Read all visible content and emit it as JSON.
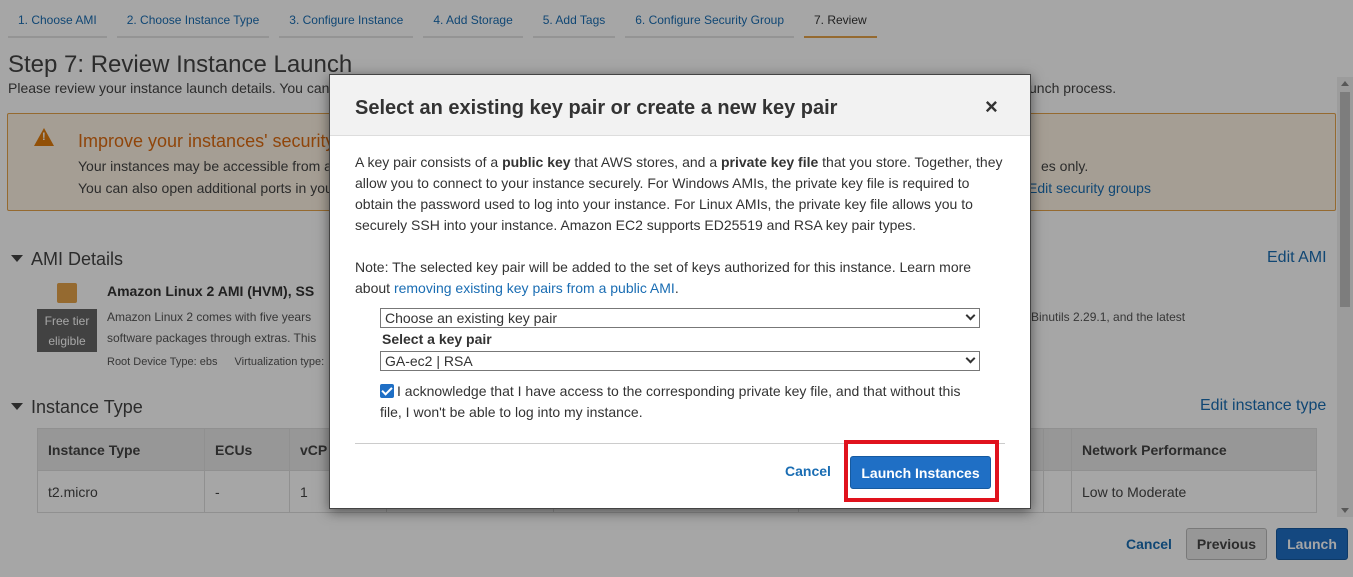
{
  "wizard": {
    "steps": [
      {
        "label": "1. Choose AMI"
      },
      {
        "label": "2. Choose Instance Type"
      },
      {
        "label": "3. Configure Instance"
      },
      {
        "label": "4. Add Storage"
      },
      {
        "label": "5. Add Tags"
      },
      {
        "label": "6. Configure Security Group"
      },
      {
        "label": "7. Review"
      }
    ]
  },
  "page": {
    "title": "Step 7: Review Instance Launch",
    "subtitle_start": "Please review your instance launch details. You can",
    "subtitle_end": "unch process."
  },
  "warning": {
    "title": "Improve your instances' security",
    "line1_start": "Your instances may be accessible from a",
    "line1_end": "es only.",
    "line2_start": "You can also open additional ports in you",
    "edit_link": "Edit security groups"
  },
  "ami": {
    "section_title": "AMI Details",
    "edit_link": "Edit AMI",
    "name": "Amazon Linux 2 AMI (HVM), SS",
    "badge": "Free tier eligible",
    "desc_line1_start": "Amazon Linux 2 comes with five years",
    "desc_line1_end": "Binutils 2.29.1, and the latest",
    "desc_line2": "software packages through extras. This",
    "meta_root": "Root Device Type: ebs",
    "meta_virt": "Virtualization type:"
  },
  "instance_type": {
    "section_title": "Instance Type",
    "edit_link": "Edit instance type",
    "columns": [
      "Instance Type",
      "ECUs",
      "vCP",
      "",
      "",
      "",
      "",
      "Network Performance"
    ],
    "rows": [
      [
        "t2.micro",
        "-",
        "1",
        "",
        "",
        "",
        "",
        "Low to Moderate"
      ]
    ]
  },
  "footer": {
    "cancel": "Cancel",
    "previous": "Previous",
    "launch": "Launch"
  },
  "modal": {
    "title": "Select an existing key pair or create a new key pair",
    "close": "×",
    "body_1": "A key pair consists of a ",
    "body_b1": "public key",
    "body_2": " that AWS stores, and a ",
    "body_b2": "private key file",
    "body_3": " that you store. Together, they allow you to connect to your instance securely. For Windows AMIs, the private key file is required to obtain the password used to log into your instance. For Linux AMIs, the private key file allows you to securely SSH into your instance. Amazon EC2 supports ED25519 and RSA key pair types.",
    "note_text": "Note: The selected key pair will be added to the set of keys authorized for this instance. Learn more about",
    "note_link": "removing existing key pairs from a public AMI",
    "note_end": ".",
    "select_mode": "Choose an existing key pair",
    "select_label": "Select a key pair",
    "select_key": "GA-ec2 | RSA",
    "acknowledge": "I acknowledge that I have access to the corresponding private key file, and that without this file, I won't be able to log into my instance.",
    "acknowledge_checked": true,
    "cancel": "Cancel",
    "launch": "Launch Instances"
  }
}
